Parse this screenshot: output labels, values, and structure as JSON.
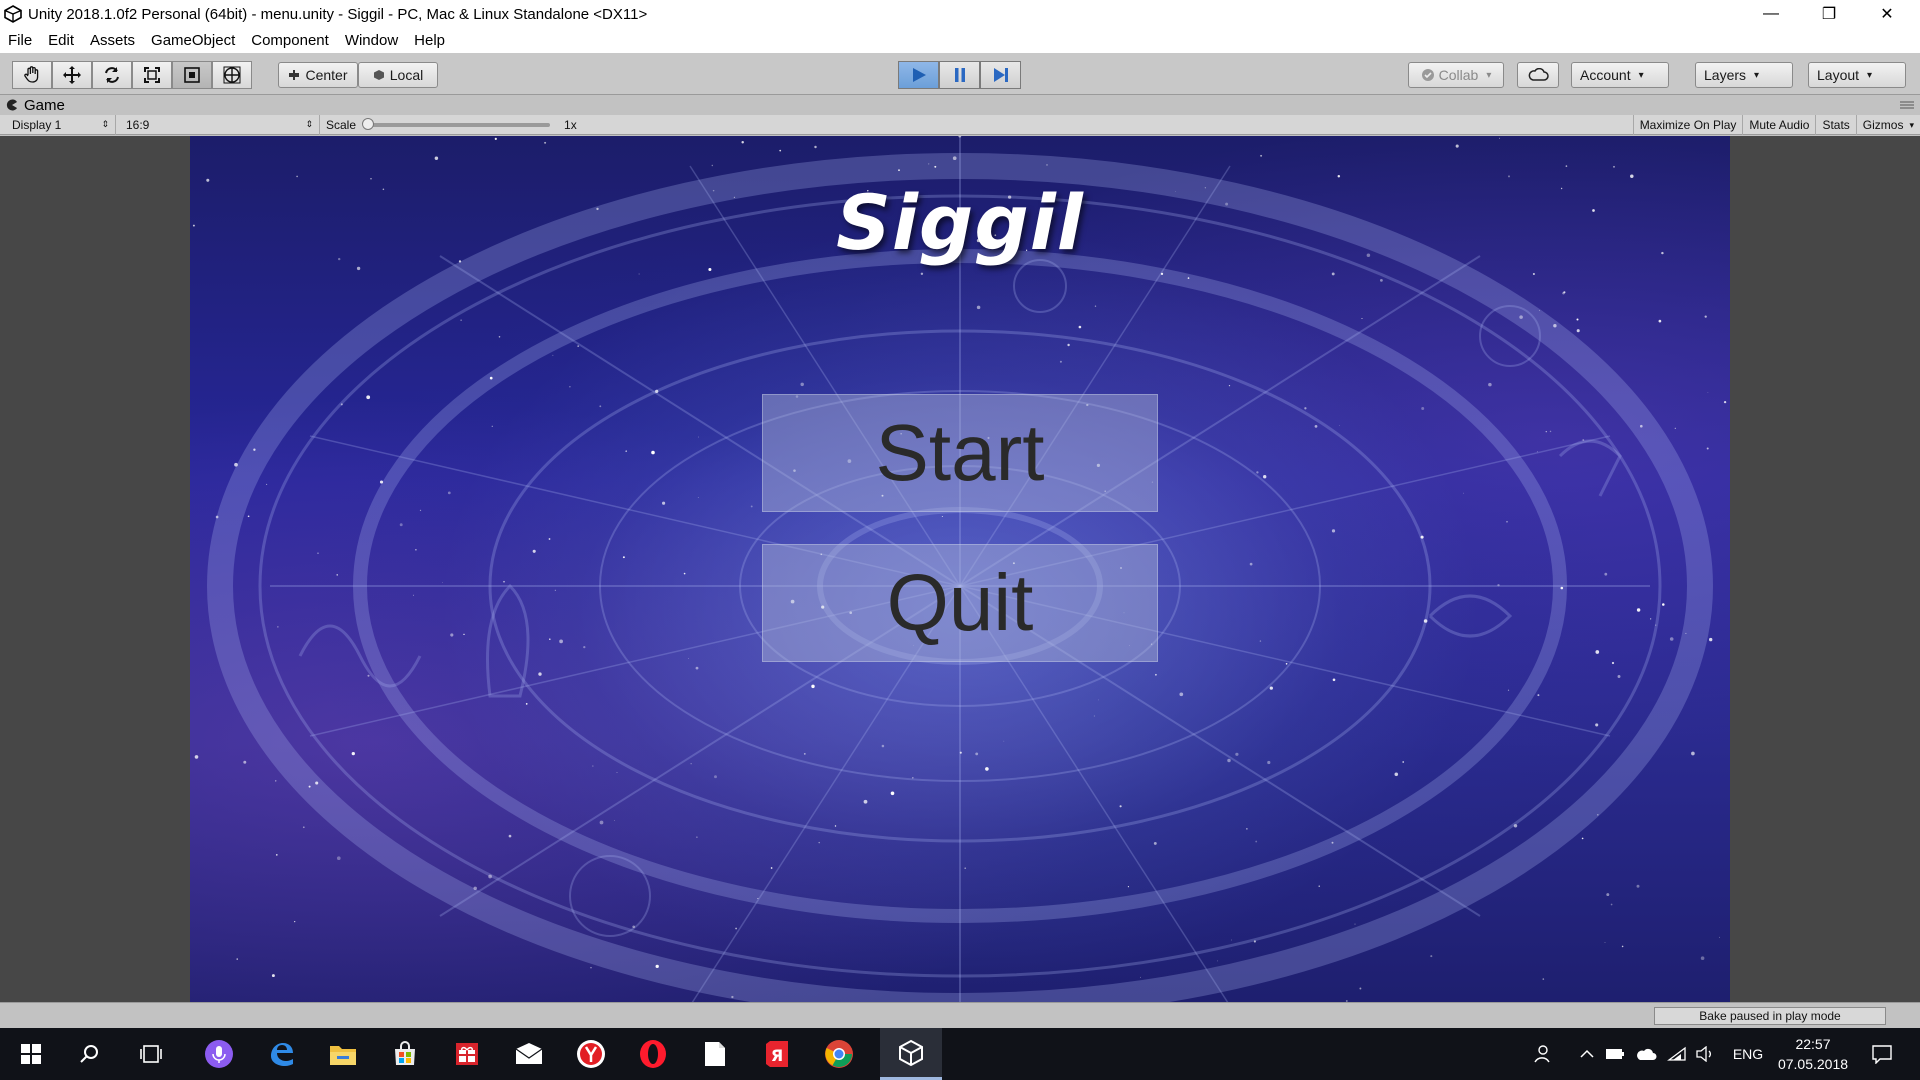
{
  "window": {
    "title": "Unity 2018.1.0f2 Personal (64bit) - menu.unity - Siggil - PC, Mac & Linux Standalone <DX11>",
    "minimize": "—",
    "restore": "❐",
    "close": "✕"
  },
  "menu": [
    "File",
    "Edit",
    "Assets",
    "GameObject",
    "Component",
    "Window",
    "Help"
  ],
  "toolbar": {
    "tools": [
      "hand-icon",
      "move-icon",
      "rotate-icon",
      "scale-icon",
      "rect-icon",
      "transform-icon"
    ],
    "center_label": "Center",
    "local_label": "Local",
    "collab_label": "Collab",
    "account_label": "Account",
    "layers_label": "Layers",
    "layout_label": "Layout"
  },
  "game_tab": {
    "label": "Game",
    "display": "Display 1",
    "aspect": "16:9",
    "scale_label": "Scale",
    "scale_value": "1x",
    "maximize": "Maximize On Play",
    "mute": "Mute Audio",
    "stats": "Stats",
    "gizmos": "Gizmos"
  },
  "game": {
    "title": "Siggil",
    "start_label": "Start",
    "quit_label": "Quit"
  },
  "status": {
    "bake": "Bake paused in play mode"
  },
  "taskbar": {
    "language": "ENG",
    "time": "22:57",
    "date": "07.05.2018"
  },
  "colors": {
    "play_active": "#6c9fd8",
    "game_bg": "#27279a"
  }
}
